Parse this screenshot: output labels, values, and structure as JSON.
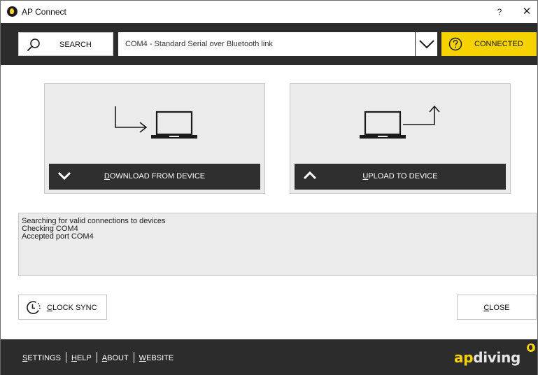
{
  "window": {
    "title": "AP Connect",
    "help_label": "?",
    "close_glyph": "✕"
  },
  "toolbar": {
    "search_label": "SEARCH",
    "search_icon": "search-icon",
    "port_value": "COM4 - Standard Serial over Bluetooth link",
    "dropdown_icon": "chevron-down-icon",
    "status_label": "CONNECTED",
    "status_icon": "question-circle-icon"
  },
  "actions": {
    "download": {
      "label_first": "D",
      "label_rest": "OWNLOAD FROM DEVICE",
      "icon": "chevron-down-icon"
    },
    "upload": {
      "label_first": "U",
      "label_rest": "PLOAD TO DEVICE",
      "icon": "chevron-up-icon"
    }
  },
  "log": {
    "lines": [
      "Searching for valid connections to devices",
      "Checking COM4",
      "Accepted port COM4"
    ]
  },
  "buttons": {
    "clock_sync_first": "C",
    "clock_sync_rest": "LOCK SYNC",
    "close_first": "C",
    "close_rest": "LOSE"
  },
  "footer": {
    "settings_first": "S",
    "settings_rest": "ETTINGS",
    "help_first": "H",
    "help_rest": "ELP",
    "about_first": "A",
    "about_rest": "BOUT",
    "website_first": "W",
    "website_rest": "EBSITE",
    "brand_ap": "ap",
    "brand_diving": "diving"
  },
  "colors": {
    "accent_yellow": "#f5d200",
    "dark_bar": "#2c2c2c",
    "card_bg": "#ebebeb"
  }
}
